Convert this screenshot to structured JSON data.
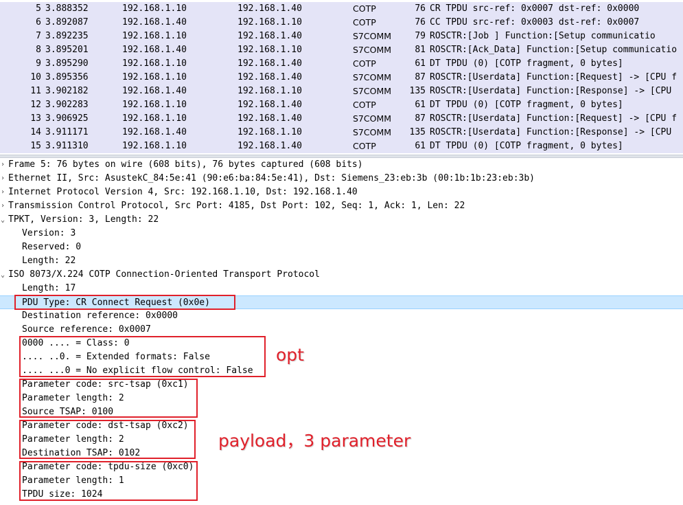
{
  "packets": [
    {
      "no": "5",
      "time": "3.888352",
      "src": "192.168.1.10",
      "dst": "192.168.1.40",
      "proto": "COTP",
      "len": "76",
      "info": "CR TPDU src-ref: 0x0007 dst-ref: 0x0000"
    },
    {
      "no": "6",
      "time": "3.892087",
      "src": "192.168.1.40",
      "dst": "192.168.1.10",
      "proto": "COTP",
      "len": "76",
      "info": "CC TPDU src-ref: 0x0003 dst-ref: 0x0007"
    },
    {
      "no": "7",
      "time": "3.892235",
      "src": "192.168.1.10",
      "dst": "192.168.1.40",
      "proto": "S7COMM",
      "len": "79",
      "info": "ROSCTR:[Job     ] Function:[Setup communicatio"
    },
    {
      "no": "8",
      "time": "3.895201",
      "src": "192.168.1.40",
      "dst": "192.168.1.10",
      "proto": "S7COMM",
      "len": "81",
      "info": "ROSCTR:[Ack_Data] Function:[Setup communicatio"
    },
    {
      "no": "9",
      "time": "3.895290",
      "src": "192.168.1.10",
      "dst": "192.168.1.40",
      "proto": "COTP",
      "len": "61",
      "info": "DT TPDU (0) [COTP fragment, 0 bytes]"
    },
    {
      "no": "10",
      "time": "3.895356",
      "src": "192.168.1.10",
      "dst": "192.168.1.40",
      "proto": "S7COMM",
      "len": "87",
      "info": "ROSCTR:[Userdata] Function:[Request] -> [CPU f"
    },
    {
      "no": "11",
      "time": "3.902182",
      "src": "192.168.1.40",
      "dst": "192.168.1.10",
      "proto": "S7COMM",
      "len": "135",
      "info": "ROSCTR:[Userdata] Function:[Response] -> [CPU "
    },
    {
      "no": "12",
      "time": "3.902283",
      "src": "192.168.1.10",
      "dst": "192.168.1.40",
      "proto": "COTP",
      "len": "61",
      "info": "DT TPDU (0) [COTP fragment, 0 bytes]"
    },
    {
      "no": "13",
      "time": "3.906925",
      "src": "192.168.1.10",
      "dst": "192.168.1.40",
      "proto": "S7COMM",
      "len": "87",
      "info": "ROSCTR:[Userdata] Function:[Request] -> [CPU f"
    },
    {
      "no": "14",
      "time": "3.911171",
      "src": "192.168.1.40",
      "dst": "192.168.1.10",
      "proto": "S7COMM",
      "len": "135",
      "info": "ROSCTR:[Userdata] Function:[Response] -> [CPU "
    },
    {
      "no": "15",
      "time": "3.911310",
      "src": "192.168.1.10",
      "dst": "192.168.1.40",
      "proto": "COTP",
      "len": "61",
      "info": "DT TPDU (0) [COTP fragment, 0 bytes]"
    }
  ],
  "details": [
    {
      "level": 0,
      "caret": "collapsed",
      "text": "Frame 5: 76 bytes on wire (608 bits), 76 bytes captured (608 bits)"
    },
    {
      "level": 0,
      "caret": "collapsed",
      "text": "Ethernet II, Src: AsustekC_84:5e:41 (90:e6:ba:84:5e:41), Dst: Siemens_23:eb:3b (00:1b:1b:23:eb:3b)"
    },
    {
      "level": 0,
      "caret": "collapsed",
      "text": "Internet Protocol Version 4, Src: 192.168.1.10, Dst: 192.168.1.40"
    },
    {
      "level": 0,
      "caret": "collapsed",
      "text": "Transmission Control Protocol, Src Port: 4185, Dst Port: 102, Seq: 1, Ack: 1, Len: 22"
    },
    {
      "level": 0,
      "caret": "expanded",
      "text": "TPKT, Version: 3, Length: 22"
    },
    {
      "level": 1,
      "text": "Version: 3"
    },
    {
      "level": 1,
      "text": "Reserved: 0"
    },
    {
      "level": 1,
      "text": "Length: 22"
    },
    {
      "level": 0,
      "caret": "expanded",
      "text": "ISO 8073/X.224 COTP Connection-Oriented Transport Protocol"
    },
    {
      "level": 1,
      "text": "Length: 17"
    },
    {
      "level": 1,
      "text": "PDU Type: CR Connect Request (0x0e)",
      "selected": true
    },
    {
      "level": 1,
      "text": "Destination reference: 0x0000"
    },
    {
      "level": 1,
      "text": "Source reference: 0x0007"
    },
    {
      "level": 1,
      "text": "0000 .... = Class: 0"
    },
    {
      "level": 1,
      "text": ".... ..0. = Extended formats: False"
    },
    {
      "level": 1,
      "text": ".... ...0 = No explicit flow control: False"
    },
    {
      "level": 1,
      "text": "Parameter code: src-tsap (0xc1)"
    },
    {
      "level": 1,
      "text": "Parameter length: 2"
    },
    {
      "level": 1,
      "text": "Source TSAP: 0100"
    },
    {
      "level": 1,
      "text": "Parameter code: dst-tsap (0xc2)"
    },
    {
      "level": 1,
      "text": "Parameter length: 2"
    },
    {
      "level": 1,
      "text": "Destination TSAP: 0102"
    },
    {
      "level": 1,
      "text": "Parameter code: tpdu-size (0xc0)"
    },
    {
      "level": 1,
      "text": "Parameter length: 1"
    },
    {
      "level": 1,
      "text": "TPDU size: 1024"
    }
  ],
  "annotations": {
    "opt_label": "opt",
    "payload_label": "payload，3 parameter",
    "color": "#e0202a"
  },
  "colors": {
    "packet_row_bg": "#e4e4f7",
    "selected_row_bg": "#cce8ff"
  },
  "icons": {
    "collapsed": "chevron-right-icon",
    "expanded": "chevron-down-icon"
  }
}
